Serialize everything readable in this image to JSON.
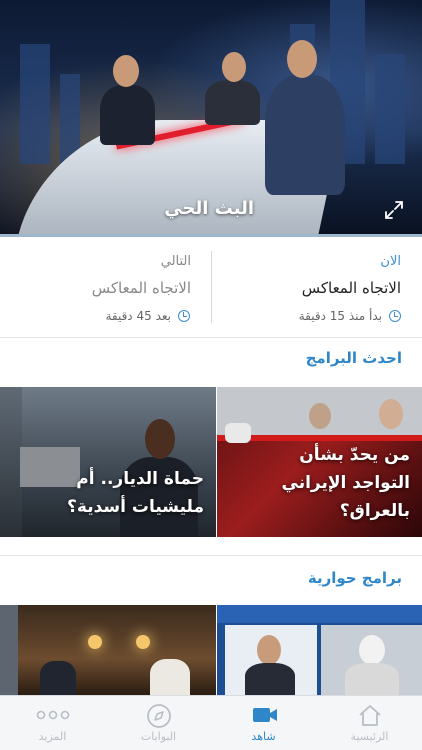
{
  "live": {
    "title": "البث الحي",
    "expand_icon": "expand-icon"
  },
  "schedule": {
    "now": {
      "label": "الان",
      "program": "الاتجاه المعاكس",
      "time": "بدأ منذ 15 دقيقة"
    },
    "next": {
      "label": "التالي",
      "program": "الاتجاه المعاكس",
      "time": "بعد 45 دقيقة"
    },
    "clock_icon": "clock-icon"
  },
  "latest_programs": {
    "title": "احدث البرامج",
    "items": [
      {
        "caption_line1": "من يحدّ بشأن",
        "caption_line2": "التواجد الإيراني",
        "caption_line3": "بالعراق؟"
      },
      {
        "caption_line1": "حماة الديار.. أم",
        "caption_line2": "مليشيات أسدية؟"
      }
    ]
  },
  "talk_shows": {
    "title": "برامج حوارية"
  },
  "tabbar": {
    "items": [
      {
        "label": "الرئيسية",
        "icon": "home-icon",
        "active": false
      },
      {
        "label": "شاهد",
        "icon": "video-camera-icon",
        "active": true
      },
      {
        "label": "البوابات",
        "icon": "compass-icon",
        "active": false
      },
      {
        "label": "المزيد",
        "icon": "more-dots-icon",
        "active": false
      }
    ]
  },
  "colors": {
    "accent": "#2f86c9",
    "tab_inactive": "#b9bec6",
    "breaking_red": "#e01e2d"
  }
}
